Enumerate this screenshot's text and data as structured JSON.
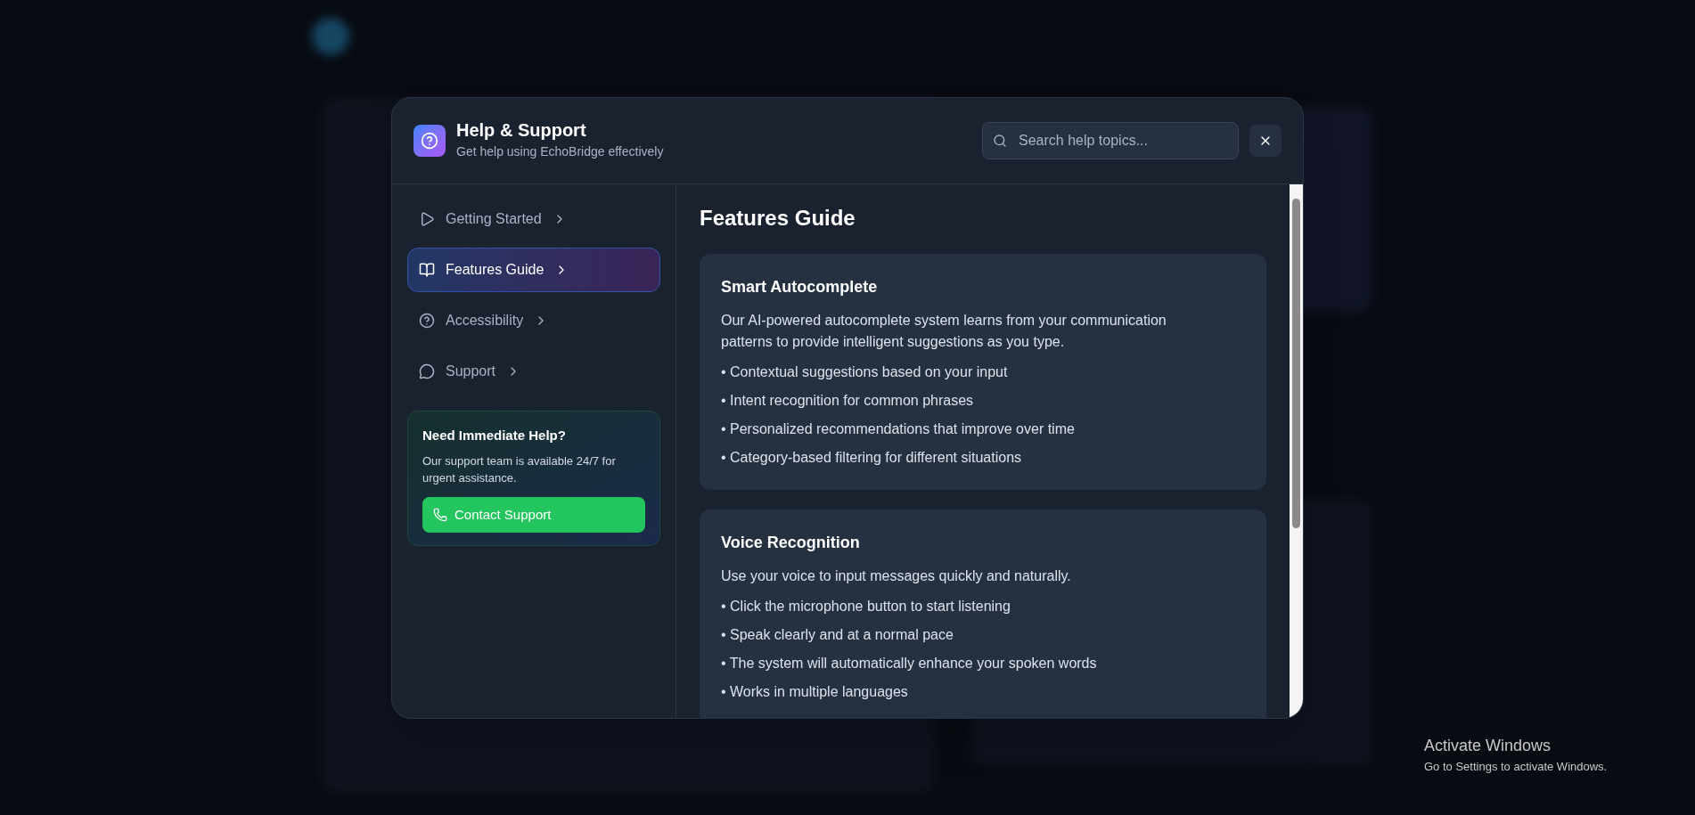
{
  "dialog": {
    "title": "Help & Support",
    "subtitle": "Get help using EchoBridge effectively",
    "search": {
      "placeholder": "Search help topics..."
    }
  },
  "sidebar": {
    "items": [
      {
        "kind": "play",
        "label": "Getting Started",
        "selected": false
      },
      {
        "kind": "book",
        "label": "Features Guide",
        "selected": true
      },
      {
        "kind": "help",
        "label": "Accessibility",
        "selected": false
      },
      {
        "kind": "chat",
        "label": "Support",
        "selected": false
      }
    ],
    "help_card": {
      "title": "Need Immediate Help?",
      "text": "Our support team is available 24/7 for urgent assistance.",
      "button": "Contact Support"
    }
  },
  "content": {
    "title": "Features Guide",
    "sections": [
      {
        "title": "Smart Autocomplete",
        "text": "Our AI-powered autocomplete system learns from your communication patterns to provide intelligent suggestions as you type.",
        "bullets": [
          "• Contextual suggestions based on your input",
          "• Intent recognition for common phrases",
          "• Personalized recommendations that improve over time",
          "• Category-based filtering for different situations"
        ]
      },
      {
        "title": "Voice Recognition",
        "text": "Use your voice to input messages quickly and naturally.",
        "bullets": [
          "• Click the microphone button to start listening",
          "• Speak clearly and at a normal pace",
          "• The system will automatically enhance your spoken words",
          "• Works in multiple languages"
        ]
      }
    ]
  },
  "os_notice": {
    "title": "Activate Windows",
    "text": "Go to Settings to activate Windows."
  }
}
